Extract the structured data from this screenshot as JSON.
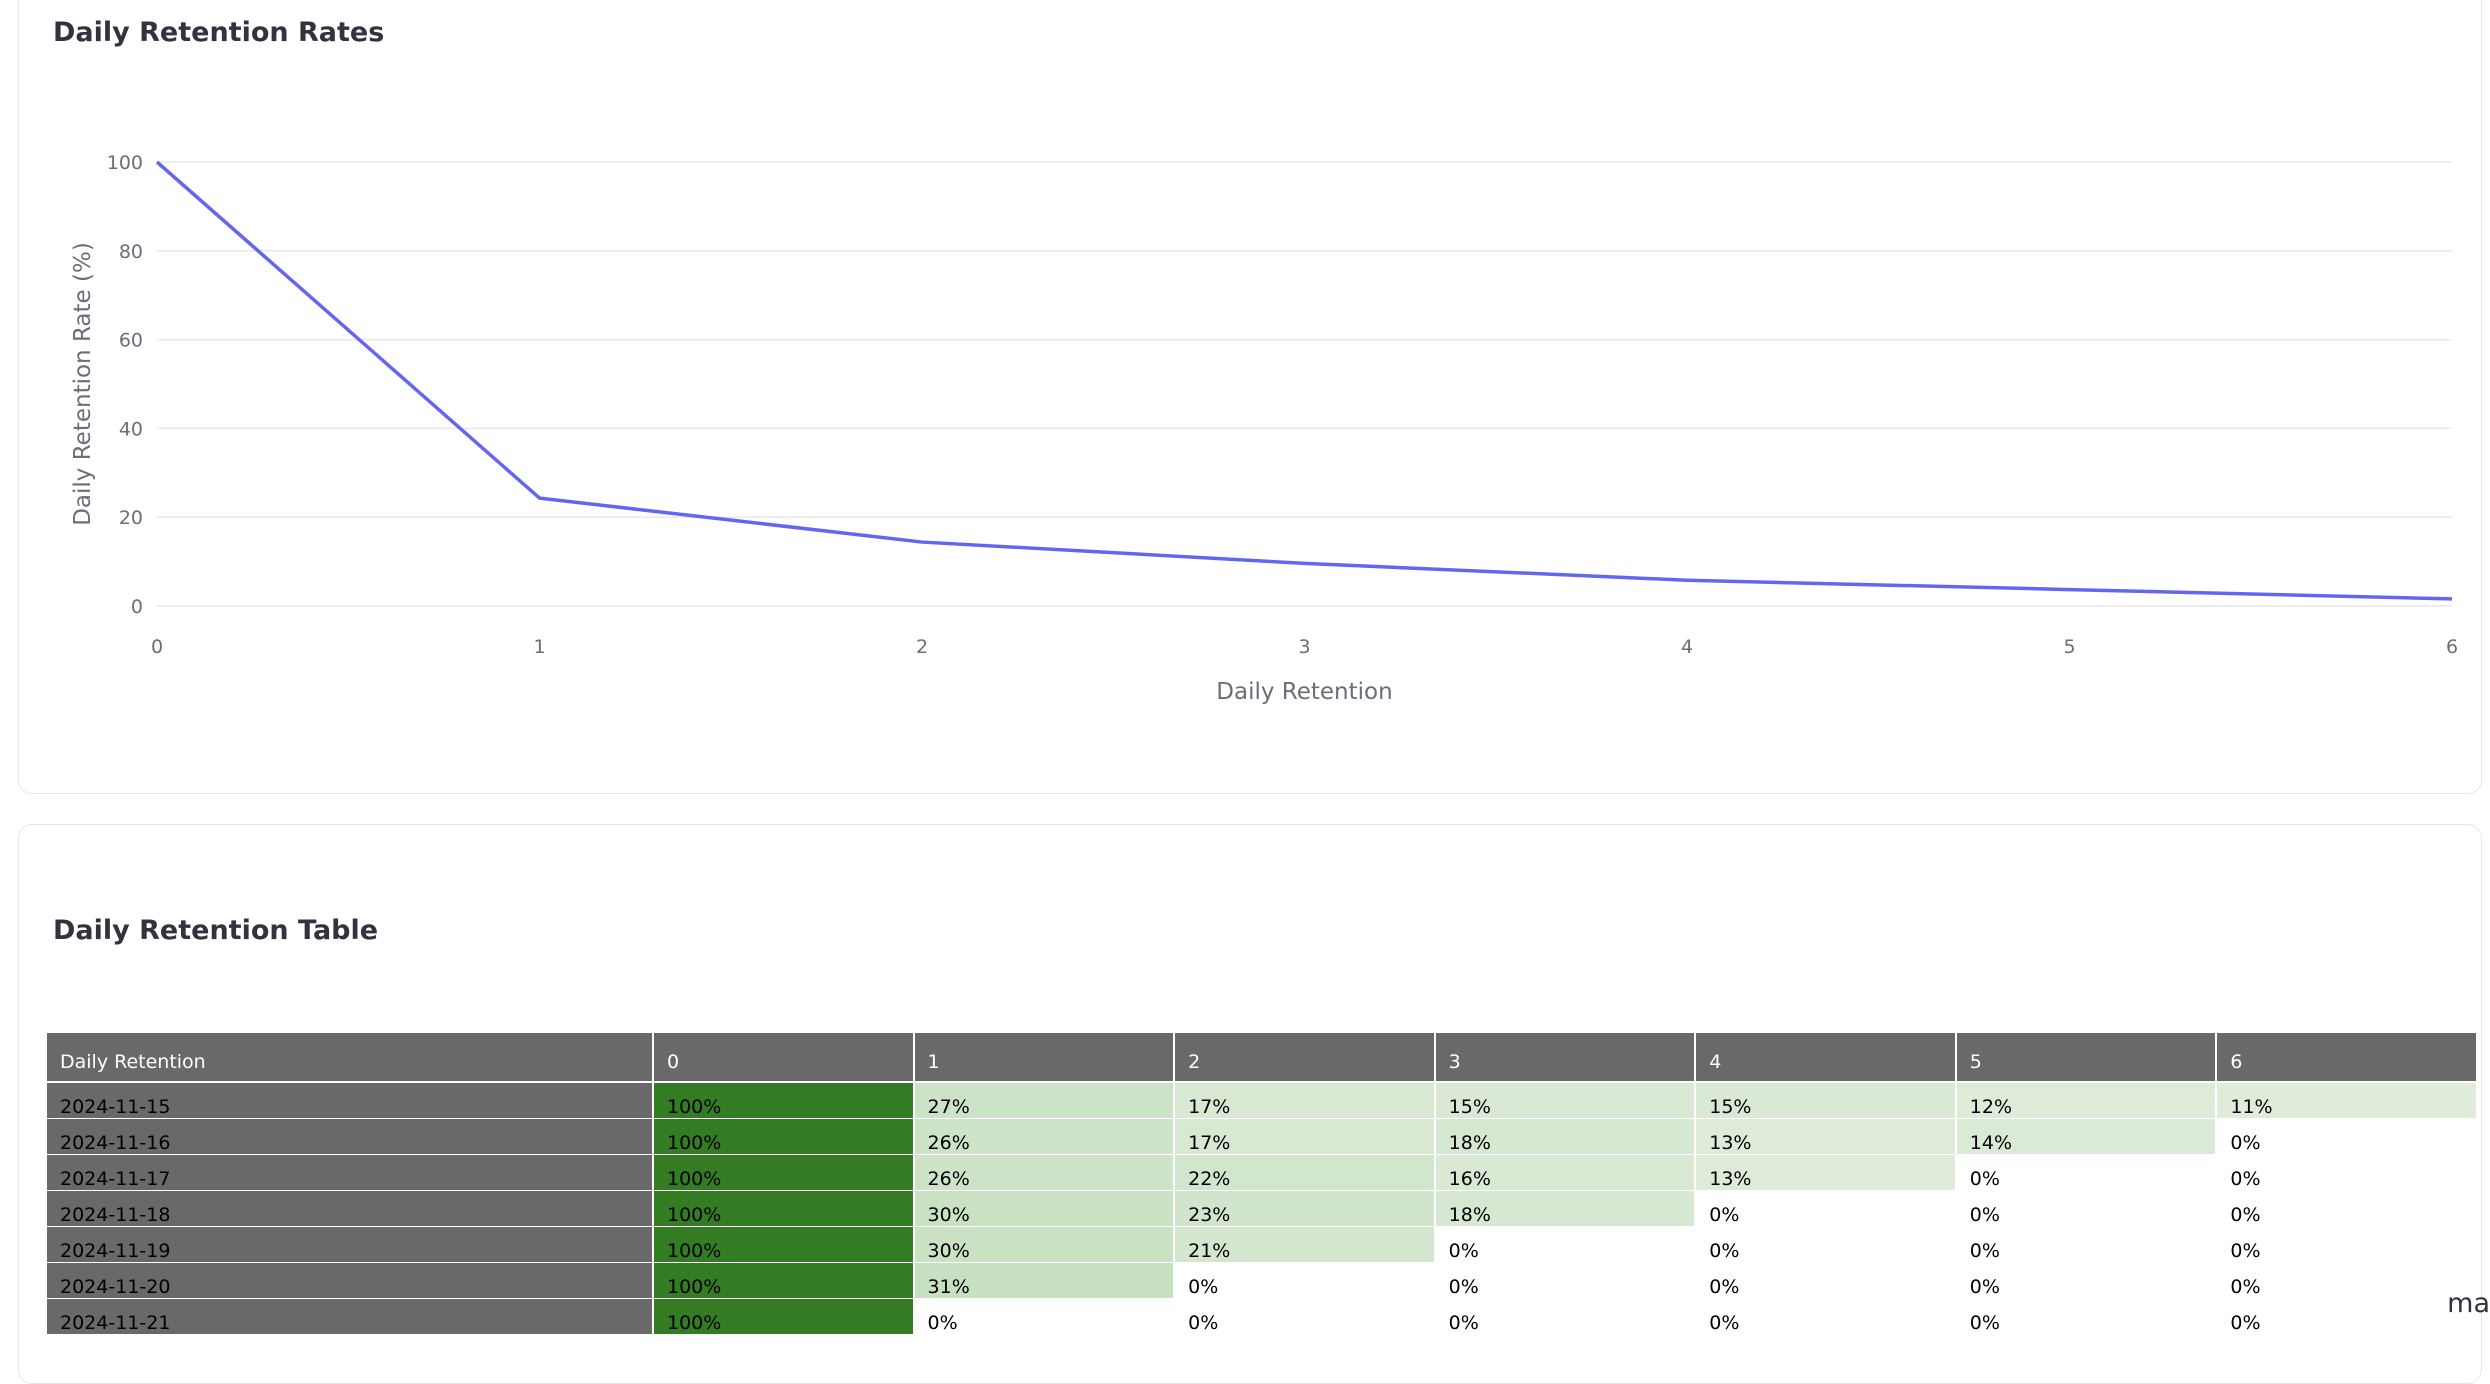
{
  "chart_section": {
    "title": "Daily Retention Rates"
  },
  "chart_data": {
    "type": "line",
    "x": [
      0,
      1,
      2,
      3,
      4,
      5,
      6
    ],
    "series": [
      {
        "values": [
          100,
          24.3,
          14.4,
          9.6,
          5.8,
          3.7,
          1.6
        ],
        "color": "#6466f1"
      }
    ],
    "xlabel": "Daily Retention",
    "ylabel": "Daily Retention Rate (%)",
    "xlim": [
      0,
      6
    ],
    "ylim": [
      0,
      100
    ],
    "xticks": [
      "0",
      "1",
      "2",
      "3",
      "4",
      "5",
      "6"
    ],
    "yticks": [
      "0",
      "20",
      "40",
      "60",
      "80",
      "100"
    ],
    "grid": true
  },
  "table_section": {
    "title": "Daily Retention Table",
    "columns": [
      "Daily Retention",
      "0",
      "1",
      "2",
      "3",
      "4",
      "5",
      "6"
    ],
    "rows": [
      {
        "label": "2024-11-15",
        "values": [
          100,
          27,
          17,
          15,
          15,
          12,
          11
        ]
      },
      {
        "label": "2024-11-16",
        "values": [
          100,
          26,
          17,
          18,
          13,
          14,
          0
        ]
      },
      {
        "label": "2024-11-17",
        "values": [
          100,
          26,
          22,
          16,
          13,
          0,
          0
        ]
      },
      {
        "label": "2024-11-18",
        "values": [
          100,
          30,
          23,
          18,
          0,
          0,
          0
        ]
      },
      {
        "label": "2024-11-19",
        "values": [
          100,
          30,
          21,
          0,
          0,
          0,
          0
        ]
      },
      {
        "label": "2024-11-20",
        "values": [
          100,
          31,
          0,
          0,
          0,
          0,
          0
        ]
      },
      {
        "label": "2024-11-21",
        "values": [
          100,
          0,
          0,
          0,
          0,
          0,
          0
        ]
      }
    ],
    "colors": {
      "header_bg": "#696969",
      "high": "#347c23"
    }
  },
  "side_text": "ma"
}
